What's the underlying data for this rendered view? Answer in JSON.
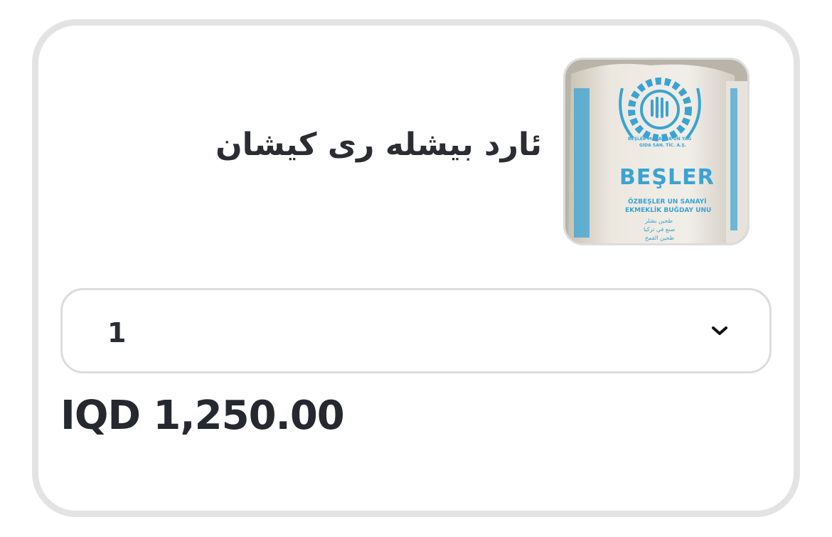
{
  "product": {
    "name": "ئارد بیشلە ری کیشان",
    "image_label": {
      "brand": "BEŞLER",
      "company_line1": "BEŞLER MAKARNA UN YAĞ",
      "company_line2": "GIDA SAN. TİC. A.Ş.",
      "subtitle1": "ÖZBEŞLER UN SANAYİ",
      "subtitle2": "EKMEKLİK BUĞDAY UNU",
      "arabic1": "طحين بشلر",
      "arabic2": "صنع في تركيا",
      "arabic3": "طحين القمح"
    }
  },
  "quantity": {
    "selected": "1",
    "icon": "chevron-down-icon"
  },
  "price": {
    "display": "IQD 1,250.00"
  },
  "colors": {
    "card_border": "#e3e3e3",
    "text": "#2b2d33",
    "bag_print": "#3aa3d3"
  }
}
